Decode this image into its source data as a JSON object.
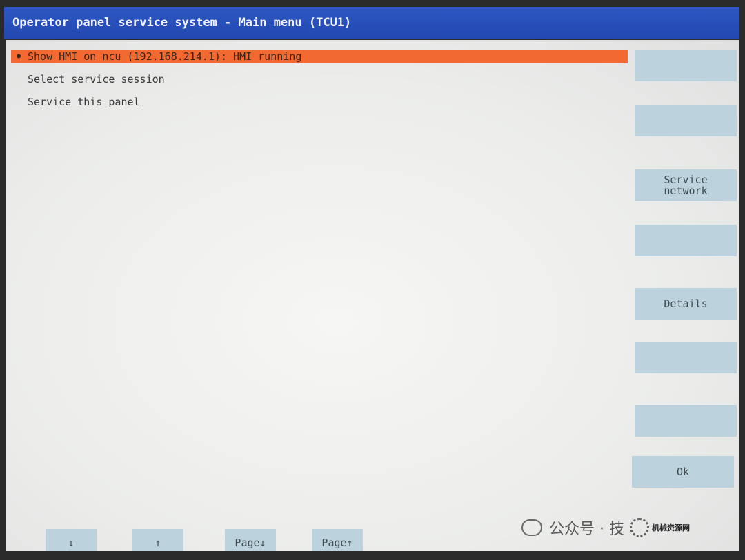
{
  "window": {
    "title": "Operator panel service system - Main menu (TCU1)"
  },
  "menu": {
    "items": [
      {
        "label": "Show HMI on ncu (192.168.214.1): HMI running",
        "selected": true
      },
      {
        "label": "Select service session",
        "selected": false
      },
      {
        "label": "Service this panel",
        "selected": false
      }
    ]
  },
  "softkeys": {
    "vertical": [
      {
        "label": ""
      },
      {
        "label": ""
      },
      {
        "label_line1": "Service",
        "label_line2": "network"
      },
      {
        "label": ""
      },
      {
        "label": "Details"
      },
      {
        "label": ""
      },
      {
        "label": ""
      },
      {
        "label": "Ok"
      }
    ],
    "horizontal": [
      {
        "label": "↓"
      },
      {
        "label": "↑"
      },
      {
        "label": "Page↓"
      },
      {
        "label": "Page↑"
      }
    ]
  },
  "watermark": {
    "text": "公众号 · 技",
    "site": "机械资源网",
    "icon": "wechat-icon",
    "logo": "gear-logo-icon"
  },
  "colors": {
    "titlebar": "#2248b0",
    "selection": "#f26a32",
    "softkey": "#bcd3de",
    "background": "#ecedeb"
  }
}
